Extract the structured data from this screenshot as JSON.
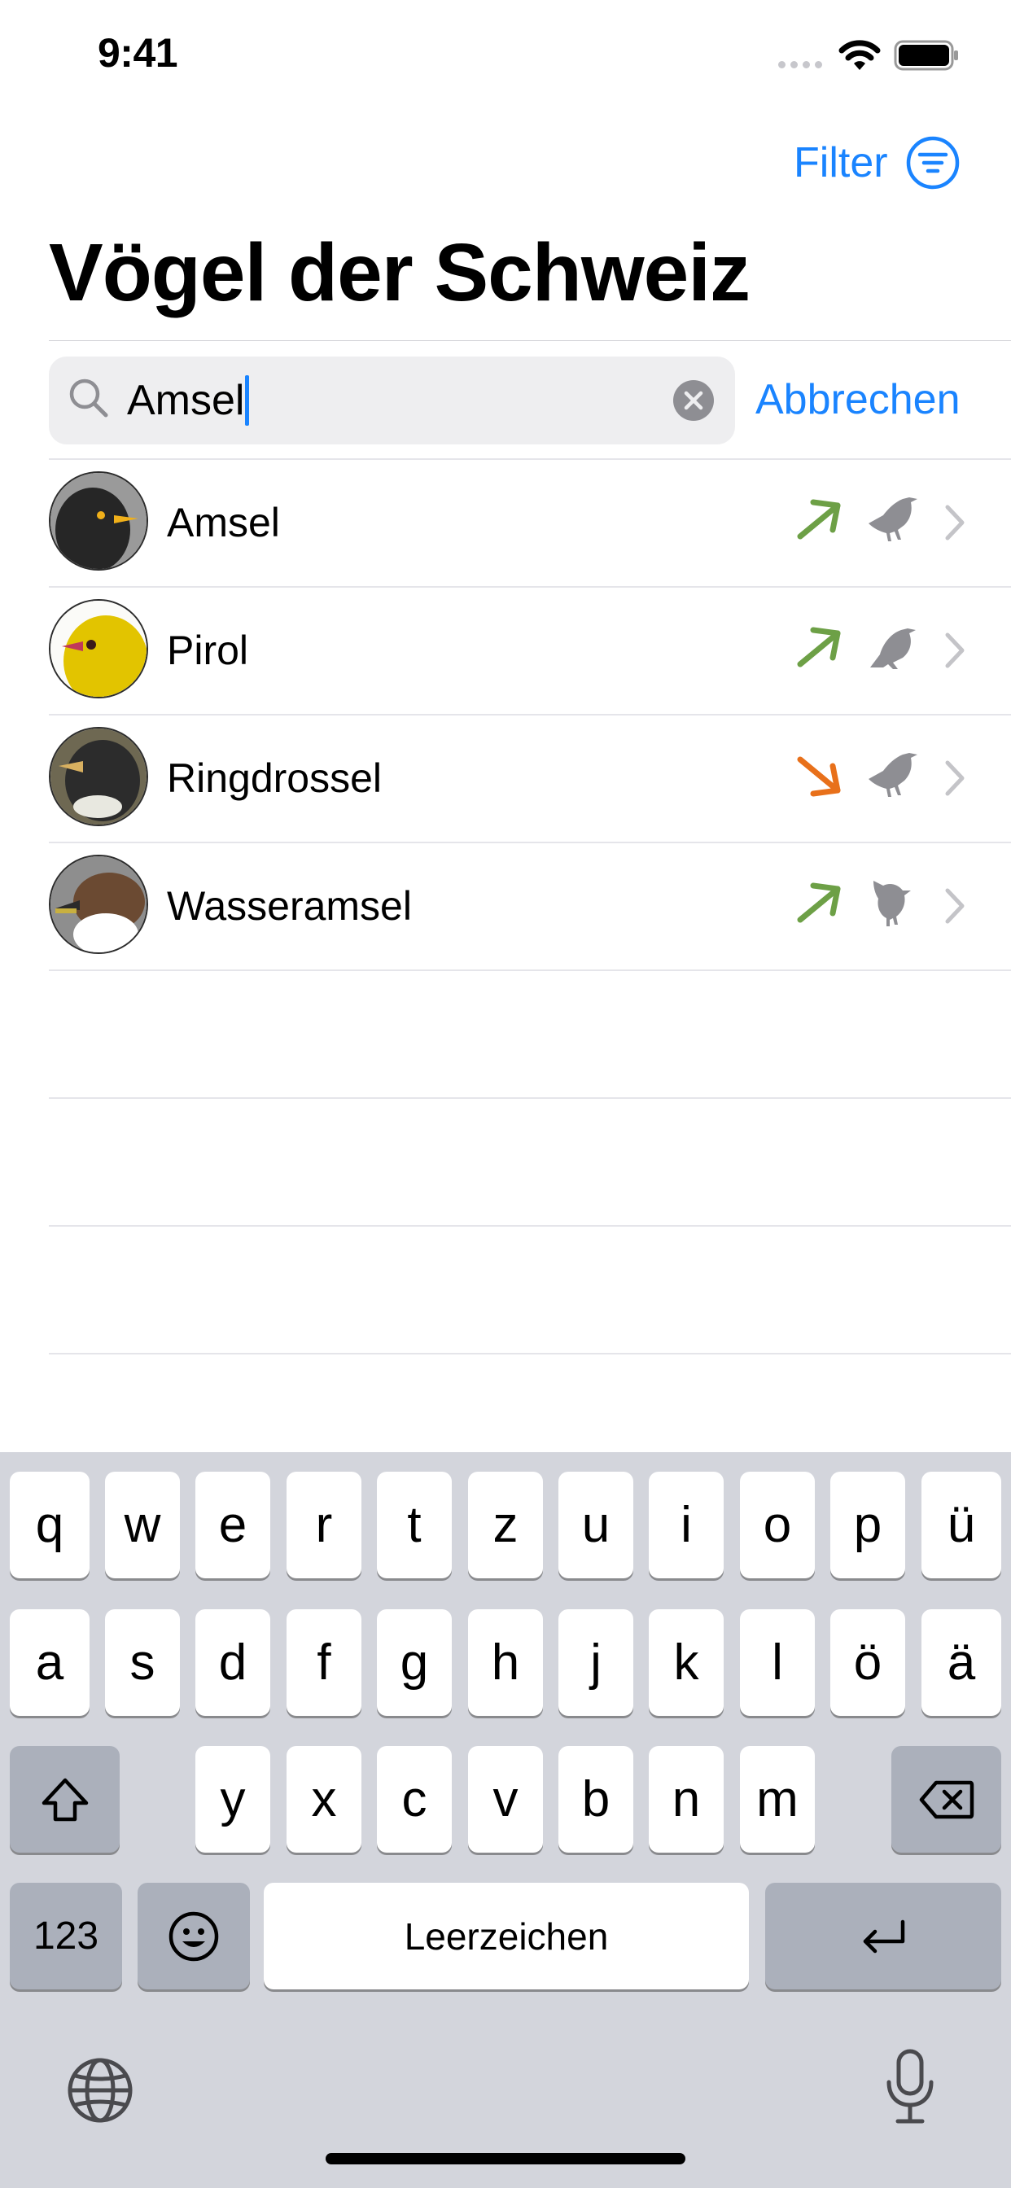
{
  "status_bar": {
    "time": "9:41"
  },
  "header": {
    "filter_label": "Filter",
    "title": "Vögel der Schweiz"
  },
  "search": {
    "value": "Amsel",
    "cancel_label": "Abbrechen"
  },
  "results": [
    {
      "name": "Amsel",
      "trend": "up",
      "trend_color": "#6da046",
      "avatar_colors": [
        "#8a8a8a",
        "#2a2a2a",
        "#f0b01a"
      ]
    },
    {
      "name": "Pirol",
      "trend": "up",
      "trend_color": "#6da046",
      "avatar_colors": [
        "#ffffff",
        "#e0c200",
        "#c0395a"
      ]
    },
    {
      "name": "Ringdrossel",
      "trend": "down",
      "trend_color": "#e8701a",
      "avatar_colors": [
        "#7a705a",
        "#2a2a2a",
        "#e8e8e0"
      ]
    },
    {
      "name": "Wasseramsel",
      "trend": "up",
      "trend_color": "#6da046",
      "avatar_colors": [
        "#8a8a8a",
        "#6b4a32",
        "#ffffff"
      ]
    }
  ],
  "keyboard": {
    "row1": [
      "q",
      "w",
      "e",
      "r",
      "t",
      "z",
      "u",
      "i",
      "o",
      "p",
      "ü"
    ],
    "row2": [
      "a",
      "s",
      "d",
      "f",
      "g",
      "h",
      "j",
      "k",
      "l",
      "ö",
      "ä"
    ],
    "row3": [
      "y",
      "x",
      "c",
      "v",
      "b",
      "n",
      "m"
    ],
    "numbers_label": "123",
    "space_label": "Leerzeichen",
    "icons": {
      "shift": "shift-icon",
      "delete": "delete-icon",
      "emoji": "emoji-icon",
      "return": "return-icon",
      "globe": "globe-icon",
      "microphone": "microphone-icon"
    }
  },
  "colors": {
    "accent": "#1a84ff",
    "trend_up": "#6da046",
    "trend_down": "#e8701a",
    "icon_gray": "#8e8e93"
  }
}
